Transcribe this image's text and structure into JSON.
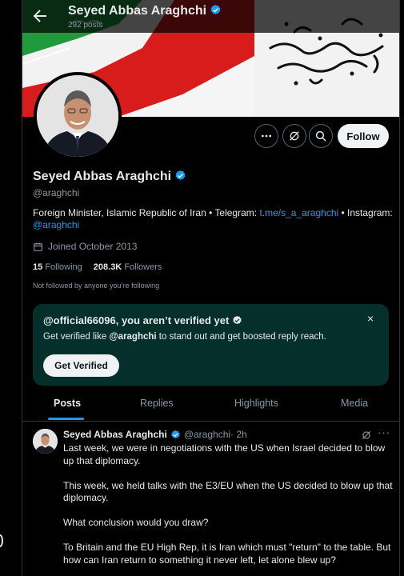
{
  "topbar": {
    "name": "Seyed Abbas Araghchi",
    "post_count": "292 posts"
  },
  "banner": {
    "calligraphy": "چو ایران نباشد تن من مباد"
  },
  "profile": {
    "name": "Seyed Abbas Araghchi",
    "handle": "@araghchi",
    "bio_prefix": "Foreign Minister, Islamic Republic of Iran • Telegram: ",
    "bio_link1": "t.me/s_a_araghchi",
    "bio_middle": " • Instagram: ",
    "bio_link2": "@araghchi",
    "joined": "Joined October 2013",
    "following_count": "15",
    "following_label": "Following",
    "followers_count": "208.3K",
    "followers_label": "Followers",
    "not_followed": "Not followed by anyone you’re following",
    "follow_label": "Follow"
  },
  "verify_card": {
    "title": "@official66096, you aren’t verified yet",
    "text_prefix": "Get verified like ",
    "text_handle": "@araghchi",
    "text_suffix": " to stand out and get boosted reply reach.",
    "close": "×",
    "button": "Get Verified"
  },
  "tabs": [
    "Posts",
    "Replies",
    "Highlights",
    "Media"
  ],
  "tweet": {
    "name": "Seyed Abbas Araghchi",
    "handle": "@araghchi",
    "time": " · 2h",
    "more": "···",
    "paragraphs": [
      "Last week, we were in negotiations with the US when Israel decided to blow up that diplomacy.",
      "This week, we held talks with the E3/EU when the US decided to blow up that diplomacy.",
      "What conclusion would you draw?",
      "To Britain and the EU High Rep, it is Iran which must \"return\" to the table. But how can Iran return to something it never left, let alone blew up?"
    ]
  },
  "colors": {
    "accent": "#1d9bf0",
    "verify_card_bg": "#042f2a",
    "flag_green": "#239f40",
    "flag_red": "#da0000"
  },
  "icons": [
    "back-arrow-icon",
    "verified-badge-icon",
    "more-icon",
    "grok-icon",
    "search-icon",
    "calendar-icon",
    "close-icon"
  ]
}
